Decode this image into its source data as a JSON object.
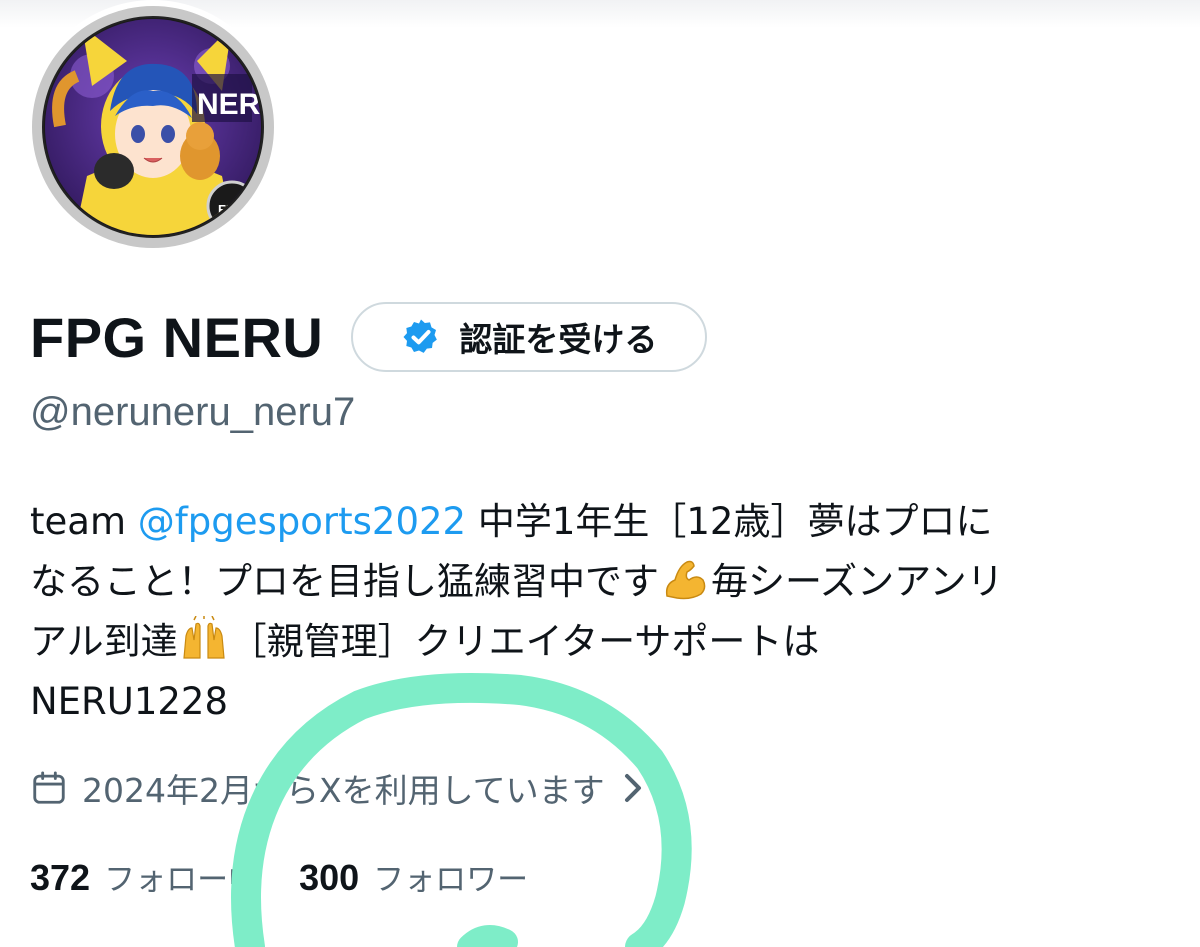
{
  "profile": {
    "display_name": "FPG NERU",
    "verify_button_label": "認証を受ける",
    "handle": "@neruneru_neru7",
    "avatar_text": "NERU",
    "avatar_badge_text": "FPG"
  },
  "bio": {
    "line1_pre": "team ",
    "line1_mention": "@fpgesports2022",
    "line1_post": " 中学1年生［12歳］夢はプロに",
    "line2_pre": "なること！プロを目指し猛練習中です",
    "line2_post": "毎シーズンアンリ",
    "line3_pre": "アル到達",
    "line3_post": "［親管理］クリエイターサポートは",
    "line4": "NERU1228",
    "emojis": [
      "flexed-biceps",
      "raising-hands"
    ]
  },
  "joined": {
    "text": "2024年2月からXを利用しています"
  },
  "counts": {
    "following_count": "372",
    "following_label": "フォロー中",
    "followers_count": "300",
    "followers_label": "フォロワー"
  },
  "colors": {
    "text_primary": "#0f1419",
    "text_secondary": "#536471",
    "link": "#1d9bf0",
    "verify_badge": "#1d9bf0",
    "border": "#cfd9de",
    "highlight_marker": "#7eedc8"
  }
}
